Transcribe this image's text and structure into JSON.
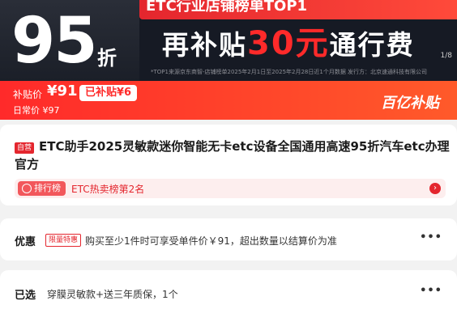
{
  "banner": {
    "big_number": "95",
    "big_suffix": "折",
    "ribbon": "ETC行业店铺榜单TOP1",
    "sub_prefix": "再补贴",
    "sub_highlight": "30元",
    "sub_suffix": "通行费",
    "page": "1/8",
    "footnote": "*TOP1来源京东商智-店铺榜单2025年2月1日至2025年2月28日近1个月数据   发行方：北京速通科技有限公司"
  },
  "price_bar": {
    "label": "补贴价",
    "price": "¥91",
    "badge": "已补贴¥6",
    "daily": "日常价 ¥97",
    "logo": "百亿补贴"
  },
  "product": {
    "self_tag": "自营",
    "title": "ETC助手2025灵敏款迷你智能无卡etc设备全国通用高速95折汽车etc办理官方",
    "rank_pill": "排行榜",
    "rank_text": "ETC热卖榜第2名"
  },
  "offer": {
    "label": "优惠",
    "tag": "限量特惠",
    "text": "购买至少1件时可享受单件价￥91，超出数量以结算价为准"
  },
  "selected": {
    "label": "已选",
    "text": "穿膜灵敏款+送三年质保，1个"
  },
  "icons": {
    "rank_icon": "trophy-icon",
    "rank_arrow": "chevron-right-icon",
    "more": "more-dots-icon"
  },
  "colors": {
    "accent": "#e4262e",
    "banner_bg": "#161a24"
  }
}
